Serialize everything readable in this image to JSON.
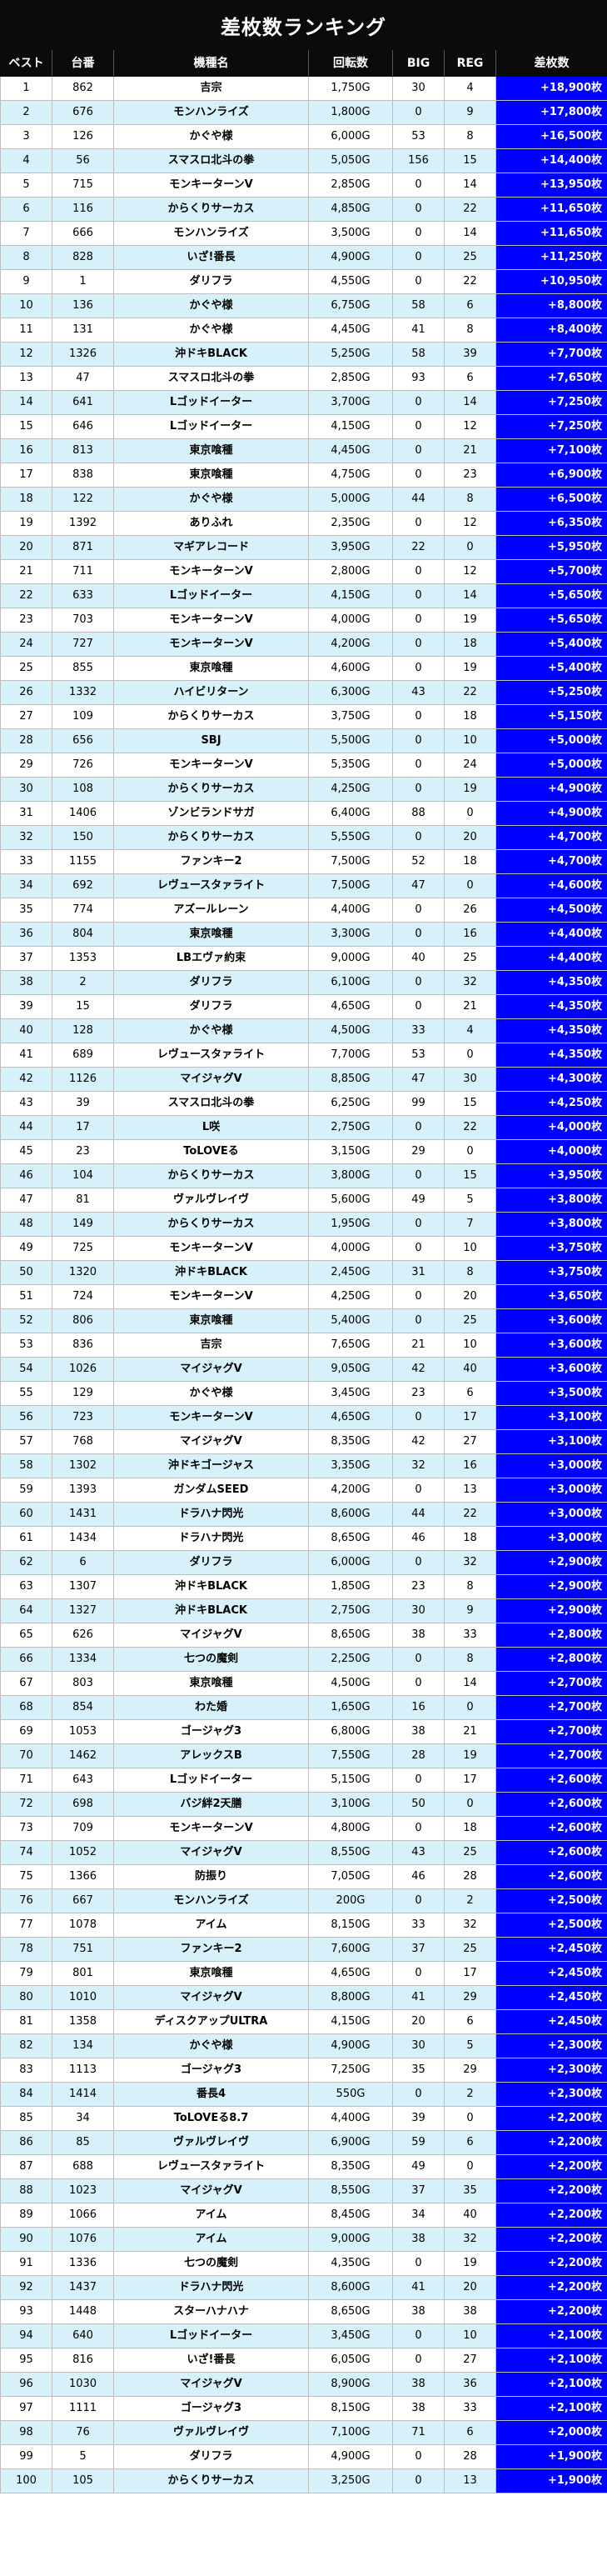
{
  "title": "差枚数ランキング",
  "headers": [
    "ベスト",
    "台番",
    "機種名",
    "回転数",
    "BIG",
    "REG",
    "差枚数"
  ],
  "rows": [
    [
      "1",
      "862",
      "吉宗",
      "1,750G",
      "30",
      "4",
      "+18,900枚"
    ],
    [
      "2",
      "676",
      "モンハンライズ",
      "1,800G",
      "0",
      "9",
      "+17,800枚"
    ],
    [
      "3",
      "126",
      "かぐや様",
      "6,000G",
      "53",
      "8",
      "+16,500枚"
    ],
    [
      "4",
      "56",
      "スマスロ北斗の拳",
      "5,050G",
      "156",
      "15",
      "+14,400枚"
    ],
    [
      "5",
      "715",
      "モンキーターンV",
      "2,850G",
      "0",
      "14",
      "+13,950枚"
    ],
    [
      "6",
      "116",
      "からくりサーカス",
      "4,850G",
      "0",
      "22",
      "+11,650枚"
    ],
    [
      "7",
      "666",
      "モンハンライズ",
      "3,500G",
      "0",
      "14",
      "+11,650枚"
    ],
    [
      "8",
      "828",
      "いざ!番長",
      "4,900G",
      "0",
      "25",
      "+11,250枚"
    ],
    [
      "9",
      "1",
      "ダリフラ",
      "4,550G",
      "0",
      "22",
      "+10,950枚"
    ],
    [
      "10",
      "136",
      "かぐや様",
      "6,750G",
      "58",
      "6",
      "+8,800枚"
    ],
    [
      "11",
      "131",
      "かぐや様",
      "4,450G",
      "41",
      "8",
      "+8,400枚"
    ],
    [
      "12",
      "1326",
      "沖ドキBLACK",
      "5,250G",
      "58",
      "39",
      "+7,700枚"
    ],
    [
      "13",
      "47",
      "スマスロ北斗の拳",
      "2,850G",
      "93",
      "6",
      "+7,650枚"
    ],
    [
      "14",
      "641",
      "Lゴッドイーター",
      "3,700G",
      "0",
      "14",
      "+7,250枚"
    ],
    [
      "15",
      "646",
      "Lゴッドイーター",
      "4,150G",
      "0",
      "12",
      "+7,250枚"
    ],
    [
      "16",
      "813",
      "東京喰種",
      "4,450G",
      "0",
      "21",
      "+7,100枚"
    ],
    [
      "17",
      "838",
      "東京喰種",
      "4,750G",
      "0",
      "23",
      "+6,900枚"
    ],
    [
      "18",
      "122",
      "かぐや様",
      "5,000G",
      "44",
      "8",
      "+6,500枚"
    ],
    [
      "19",
      "1392",
      "ありふれ",
      "2,350G",
      "0",
      "12",
      "+6,350枚"
    ],
    [
      "20",
      "871",
      "マギアレコード",
      "3,950G",
      "22",
      "0",
      "+5,950枚"
    ],
    [
      "21",
      "711",
      "モンキーターンV",
      "2,800G",
      "0",
      "12",
      "+5,700枚"
    ],
    [
      "22",
      "633",
      "Lゴッドイーター",
      "4,150G",
      "0",
      "14",
      "+5,650枚"
    ],
    [
      "23",
      "703",
      "モンキーターンV",
      "4,000G",
      "0",
      "19",
      "+5,650枚"
    ],
    [
      "24",
      "727",
      "モンキーターンV",
      "4,200G",
      "0",
      "18",
      "+5,400枚"
    ],
    [
      "25",
      "855",
      "東京喰種",
      "4,600G",
      "0",
      "19",
      "+5,400枚"
    ],
    [
      "26",
      "1332",
      "ハイビリターン",
      "6,300G",
      "43",
      "22",
      "+5,250枚"
    ],
    [
      "27",
      "109",
      "からくりサーカス",
      "3,750G",
      "0",
      "18",
      "+5,150枚"
    ],
    [
      "28",
      "656",
      "SBJ",
      "5,500G",
      "0",
      "10",
      "+5,000枚"
    ],
    [
      "29",
      "726",
      "モンキーターンV",
      "5,350G",
      "0",
      "24",
      "+5,000枚"
    ],
    [
      "30",
      "108",
      "からくりサーカス",
      "4,250G",
      "0",
      "19",
      "+4,900枚"
    ],
    [
      "31",
      "1406",
      "ゾンビランドサガ",
      "6,400G",
      "88",
      "0",
      "+4,900枚"
    ],
    [
      "32",
      "150",
      "からくりサーカス",
      "5,550G",
      "0",
      "20",
      "+4,700枚"
    ],
    [
      "33",
      "1155",
      "ファンキー2",
      "7,500G",
      "52",
      "18",
      "+4,700枚"
    ],
    [
      "34",
      "692",
      "レヴュースタァライト",
      "7,500G",
      "47",
      "0",
      "+4,600枚"
    ],
    [
      "35",
      "774",
      "アズールレーン",
      "4,400G",
      "0",
      "26",
      "+4,500枚"
    ],
    [
      "36",
      "804",
      "東京喰種",
      "3,300G",
      "0",
      "16",
      "+4,400枚"
    ],
    [
      "37",
      "1353",
      "LBエヴァ約束",
      "9,000G",
      "40",
      "25",
      "+4,400枚"
    ],
    [
      "38",
      "2",
      "ダリフラ",
      "6,100G",
      "0",
      "32",
      "+4,350枚"
    ],
    [
      "39",
      "15",
      "ダリフラ",
      "4,650G",
      "0",
      "21",
      "+4,350枚"
    ],
    [
      "40",
      "128",
      "かぐや様",
      "4,500G",
      "33",
      "4",
      "+4,350枚"
    ],
    [
      "41",
      "689",
      "レヴュースタァライト",
      "7,700G",
      "53",
      "0",
      "+4,350枚"
    ],
    [
      "42",
      "1126",
      "マイジャグV",
      "8,850G",
      "47",
      "30",
      "+4,300枚"
    ],
    [
      "43",
      "39",
      "スマスロ北斗の拳",
      "6,250G",
      "99",
      "15",
      "+4,250枚"
    ],
    [
      "44",
      "17",
      "L咲",
      "2,750G",
      "0",
      "22",
      "+4,000枚"
    ],
    [
      "45",
      "23",
      "ToLOVEる",
      "3,150G",
      "29",
      "0",
      "+4,000枚"
    ],
    [
      "46",
      "104",
      "からくりサーカス",
      "3,800G",
      "0",
      "15",
      "+3,950枚"
    ],
    [
      "47",
      "81",
      "ヴァルヴレイヴ",
      "5,600G",
      "49",
      "5",
      "+3,800枚"
    ],
    [
      "48",
      "149",
      "からくりサーカス",
      "1,950G",
      "0",
      "7",
      "+3,800枚"
    ],
    [
      "49",
      "725",
      "モンキーターンV",
      "4,000G",
      "0",
      "10",
      "+3,750枚"
    ],
    [
      "50",
      "1320",
      "沖ドキBLACK",
      "2,450G",
      "31",
      "8",
      "+3,750枚"
    ],
    [
      "51",
      "724",
      "モンキーターンV",
      "4,250G",
      "0",
      "20",
      "+3,650枚"
    ],
    [
      "52",
      "806",
      "東京喰種",
      "5,400G",
      "0",
      "25",
      "+3,600枚"
    ],
    [
      "53",
      "836",
      "吉宗",
      "7,650G",
      "21",
      "10",
      "+3,600枚"
    ],
    [
      "54",
      "1026",
      "マイジャグV",
      "9,050G",
      "42",
      "40",
      "+3,600枚"
    ],
    [
      "55",
      "129",
      "かぐや様",
      "3,450G",
      "23",
      "6",
      "+3,500枚"
    ],
    [
      "56",
      "723",
      "モンキーターンV",
      "4,650G",
      "0",
      "17",
      "+3,100枚"
    ],
    [
      "57",
      "768",
      "マイジャグV",
      "8,350G",
      "42",
      "27",
      "+3,100枚"
    ],
    [
      "58",
      "1302",
      "沖ドキゴージャス",
      "3,350G",
      "32",
      "16",
      "+3,000枚"
    ],
    [
      "59",
      "1393",
      "ガンダムSEED",
      "4,200G",
      "0",
      "13",
      "+3,000枚"
    ],
    [
      "60",
      "1431",
      "ドラハナ閃光",
      "8,600G",
      "44",
      "22",
      "+3,000枚"
    ],
    [
      "61",
      "1434",
      "ドラハナ閃光",
      "8,650G",
      "46",
      "18",
      "+3,000枚"
    ],
    [
      "62",
      "6",
      "ダリフラ",
      "6,000G",
      "0",
      "32",
      "+2,900枚"
    ],
    [
      "63",
      "1307",
      "沖ドキBLACK",
      "1,850G",
      "23",
      "8",
      "+2,900枚"
    ],
    [
      "64",
      "1327",
      "沖ドキBLACK",
      "2,750G",
      "30",
      "9",
      "+2,900枚"
    ],
    [
      "65",
      "626",
      "マイジャグV",
      "8,650G",
      "38",
      "33",
      "+2,800枚"
    ],
    [
      "66",
      "1334",
      "七つの魔剣",
      "2,250G",
      "0",
      "8",
      "+2,800枚"
    ],
    [
      "67",
      "803",
      "東京喰種",
      "4,500G",
      "0",
      "14",
      "+2,700枚"
    ],
    [
      "68",
      "854",
      "わた婚",
      "1,650G",
      "16",
      "0",
      "+2,700枚"
    ],
    [
      "69",
      "1053",
      "ゴージャグ3",
      "6,800G",
      "38",
      "21",
      "+2,700枚"
    ],
    [
      "70",
      "1462",
      "アレックスB",
      "7,550G",
      "28",
      "19",
      "+2,700枚"
    ],
    [
      "71",
      "643",
      "Lゴッドイーター",
      "5,150G",
      "0",
      "17",
      "+2,600枚"
    ],
    [
      "72",
      "698",
      "バジ絆2天膳",
      "3,100G",
      "50",
      "0",
      "+2,600枚"
    ],
    [
      "73",
      "709",
      "モンキーターンV",
      "4,800G",
      "0",
      "18",
      "+2,600枚"
    ],
    [
      "74",
      "1052",
      "マイジャグV",
      "8,550G",
      "43",
      "25",
      "+2,600枚"
    ],
    [
      "75",
      "1366",
      "防振り",
      "7,050G",
      "46",
      "28",
      "+2,600枚"
    ],
    [
      "76",
      "667",
      "モンハンライズ",
      "200G",
      "0",
      "2",
      "+2,500枚"
    ],
    [
      "77",
      "1078",
      "アイム",
      "8,150G",
      "33",
      "32",
      "+2,500枚"
    ],
    [
      "78",
      "751",
      "ファンキー2",
      "7,600G",
      "37",
      "25",
      "+2,450枚"
    ],
    [
      "79",
      "801",
      "東京喰種",
      "4,650G",
      "0",
      "17",
      "+2,450枚"
    ],
    [
      "80",
      "1010",
      "マイジャグV",
      "8,800G",
      "41",
      "29",
      "+2,450枚"
    ],
    [
      "81",
      "1358",
      "ディスクアップULTRA",
      "4,150G",
      "20",
      "6",
      "+2,450枚"
    ],
    [
      "82",
      "134",
      "かぐや様",
      "4,900G",
      "30",
      "5",
      "+2,300枚"
    ],
    [
      "83",
      "1113",
      "ゴージャグ3",
      "7,250G",
      "35",
      "29",
      "+2,300枚"
    ],
    [
      "84",
      "1414",
      "番長4",
      "550G",
      "0",
      "2",
      "+2,300枚"
    ],
    [
      "85",
      "34",
      "ToLOVEる8.7",
      "4,400G",
      "39",
      "0",
      "+2,200枚"
    ],
    [
      "86",
      "85",
      "ヴァルヴレイヴ",
      "6,900G",
      "59",
      "6",
      "+2,200枚"
    ],
    [
      "87",
      "688",
      "レヴュースタァライト",
      "8,350G",
      "49",
      "0",
      "+2,200枚"
    ],
    [
      "88",
      "1023",
      "マイジャグV",
      "8,550G",
      "37",
      "35",
      "+2,200枚"
    ],
    [
      "89",
      "1066",
      "アイム",
      "8,450G",
      "34",
      "40",
      "+2,200枚"
    ],
    [
      "90",
      "1076",
      "アイム",
      "9,000G",
      "38",
      "32",
      "+2,200枚"
    ],
    [
      "91",
      "1336",
      "七つの魔剣",
      "4,350G",
      "0",
      "19",
      "+2,200枚"
    ],
    [
      "92",
      "1437",
      "ドラハナ閃光",
      "8,600G",
      "41",
      "20",
      "+2,200枚"
    ],
    [
      "93",
      "1448",
      "スターハナハナ",
      "8,650G",
      "38",
      "38",
      "+2,200枚"
    ],
    [
      "94",
      "640",
      "Lゴッドイーター",
      "3,450G",
      "0",
      "10",
      "+2,100枚"
    ],
    [
      "95",
      "816",
      "いざ!番長",
      "6,050G",
      "0",
      "27",
      "+2,100枚"
    ],
    [
      "96",
      "1030",
      "マイジャグV",
      "8,900G",
      "38",
      "36",
      "+2,100枚"
    ],
    [
      "97",
      "1111",
      "ゴージャグ3",
      "8,150G",
      "38",
      "33",
      "+2,100枚"
    ],
    [
      "98",
      "76",
      "ヴァルヴレイヴ",
      "7,100G",
      "71",
      "6",
      "+2,000枚"
    ],
    [
      "99",
      "5",
      "ダリフラ",
      "4,900G",
      "0",
      "28",
      "+1,900枚"
    ],
    [
      "100",
      "105",
      "からくりサーカス",
      "3,250G",
      "0",
      "13",
      "+1,900枚"
    ]
  ]
}
